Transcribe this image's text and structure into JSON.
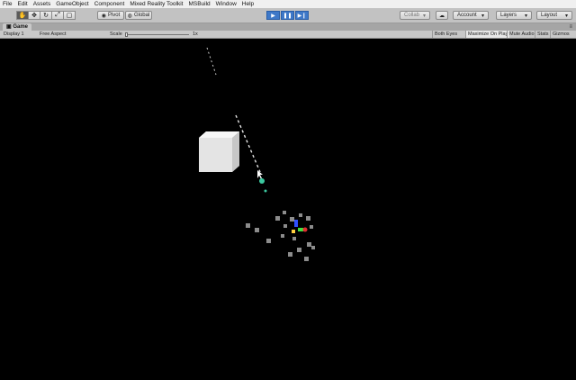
{
  "menu": [
    "File",
    "Edit",
    "Assets",
    "GameObject",
    "Component",
    "Mixed Reality Toolkit",
    "MSBuild",
    "Window",
    "Help"
  ],
  "toolbar": {
    "pivot_label": "Pivot",
    "global_label": "Global",
    "collab_label": "Collab",
    "account_label": "Account",
    "layers_label": "Layers",
    "layout_label": "Layout",
    "dropdown_arrow": "▾"
  },
  "tab": {
    "title": "Game",
    "menu_glyph": "≡"
  },
  "game_toolbar": {
    "display": "Display 1",
    "aspect": "Free Aspect",
    "scale_label": "Scale",
    "scale_value": "1x",
    "eye": "Both Eyes",
    "maximize": "Maximize On Play",
    "mute": "Mute Audio",
    "stats": "Stats",
    "gizmos": "Gizmos"
  },
  "colors": {
    "menubar": "#f0f0f0",
    "toolbar": "#c2c2c2",
    "play_active": "#3e78c8",
    "viewport": "#000000"
  }
}
